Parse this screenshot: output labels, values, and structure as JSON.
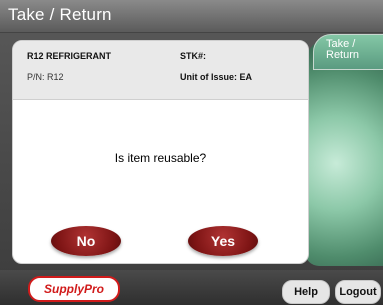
{
  "header": {
    "title": "Take / Return"
  },
  "side_tab": {
    "label": "Take / Return"
  },
  "item_info": {
    "name": "R12 REFRIGERANT",
    "stk_label": "STK#:",
    "pn": "P/N: R12",
    "unit_issue": "Unit of Issue: EA"
  },
  "dialog": {
    "question": "Is item reusable?",
    "no_label": "No",
    "yes_label": "Yes"
  },
  "footer": {
    "logo_text": "SupplyPro",
    "help_label": "Help",
    "logout_label": "Logout"
  }
}
